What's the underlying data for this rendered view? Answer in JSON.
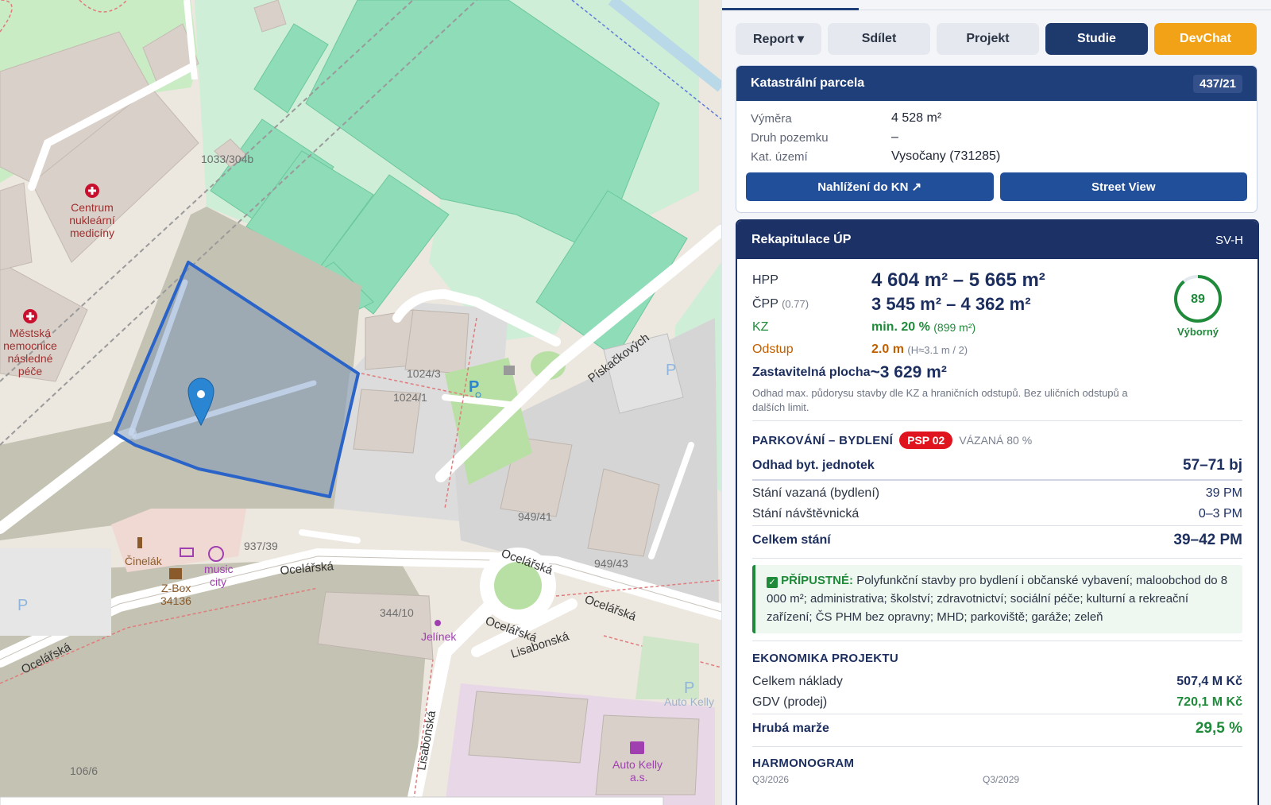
{
  "map": {
    "labels": {
      "parcel_1033": "1033/304b",
      "centrum": [
        "Centrum",
        "nukleární",
        "medicíny"
      ],
      "mestska": [
        "Městská",
        "nemocnice",
        "následné",
        "péče"
      ],
      "parcel_1024_3": "1024/3",
      "parcel_1024_1": "1024/1",
      "piskackovych": "Pískačkových",
      "parcel_949_41": "949/41",
      "parcel_949_43": "949/43",
      "parcel_937_39": "937/39",
      "ocelarska_1": "Ocelářská",
      "ocelarska_2": "Ocelářská",
      "ocelarska_3": "Ocelářská",
      "ocelarska_4": "Ocelářská",
      "ocelarska_5": "Ocelářská",
      "cinelak": "Činelák",
      "zbox": [
        "Z-Box",
        "34136"
      ],
      "music_city": [
        "music",
        "city"
      ],
      "parcel_344_10": "344/10",
      "jelinek": "Jelínek",
      "lisabonska_1": "Lisabonská",
      "lisabonska_2": "Lisabonská",
      "auto_kelly": [
        "Auto Kelly",
        "a.s."
      ],
      "auto_kelly_faded": "Auto Kelly",
      "parcel_106_6": "106/6",
      "parking": "P"
    }
  },
  "toolbar": {
    "report": "Report ▾",
    "share": "Sdílet",
    "project": "Projekt",
    "study": "Studie",
    "devchat": "DevChat"
  },
  "parcel": {
    "title": "Katastrální parcela",
    "number": "437/21",
    "rows": [
      {
        "k": "Výměra",
        "v": "4 528 m²"
      },
      {
        "k": "Druh pozemku",
        "v": "–"
      },
      {
        "k": "Kat. území",
        "v": "Vysočany (731285)"
      }
    ],
    "btn_kn": "Nahlížení do KN ↗",
    "btn_sv": "Street View"
  },
  "recap": {
    "title": "Rekapitulace ÚP",
    "code": "SV-H",
    "hpp_label": "HPP",
    "hpp_value": "4 604 m² – 5 665 m²",
    "cpp_label": "ČPP",
    "cpp_note": "(0.77)",
    "cpp_value": "3 545 m² – 4 362 m²",
    "kz_label": "KZ",
    "kz_value": "min. 20 %",
    "kz_note": "(899 m²)",
    "odstup_label": "Odstup",
    "odstup_value": "2.0 m",
    "odstup_note": "(H≈3.1 m / 2)",
    "zast_label": "Zastavitelná plocha",
    "zast_value": "~3 629 m²",
    "zast_note": "Odhad max. půdorysu stavby dle KZ a hraničních odstupů. Bez uličních odstupů a dalších limit.",
    "score": "89",
    "score_label": "Výborný",
    "score_fraction": 0.89,
    "parking_title": "PARKOVÁNÍ – BYDLENÍ",
    "parking_badge": "PSP 02",
    "parking_bound": "VÁZANÁ 80 %",
    "units_label": "Odhad byt. jednotek",
    "units_value": "57–71 bj",
    "stani_vaz_label": "Stání vazaná (bydlení)",
    "stani_vaz_value": "39 PM",
    "stani_nav_label": "Stání návštěvnická",
    "stani_nav_value": "0–3 PM",
    "stani_total_label": "Celkem stání",
    "stani_total_value": "39–42 PM",
    "allowed_title": "PŘÍPUSTNÉ:",
    "allowed_text": "Polyfunkční stavby pro bydlení i občanské vybavení; maloobchod do 8 000 m²; administrativa; školství; zdravotnictví; sociální péče; kulturní a rekreační zařízení; ČS PHM bez opravny; MHD; parkoviště; garáže; zeleň",
    "econ_title": "EKONOMIKA PROJEKTU",
    "cost_label": "Celkem náklady",
    "cost_value": "507,4 M Kč",
    "gdv_label": "GDV (prodej)",
    "gdv_value": "720,1 M Kč",
    "margin_label": "Hrubá marže",
    "margin_value": "29,5 %",
    "harm_title": "HARMONOGRAM",
    "harm_start": "Q3/2026",
    "harm_end": "Q3/2029"
  },
  "colors": {
    "navy": "#1e3a6c",
    "orange": "#f2a217",
    "green": "#1f8a3a",
    "red": "#e0141e",
    "parcel_outline": "#2b64c8"
  }
}
